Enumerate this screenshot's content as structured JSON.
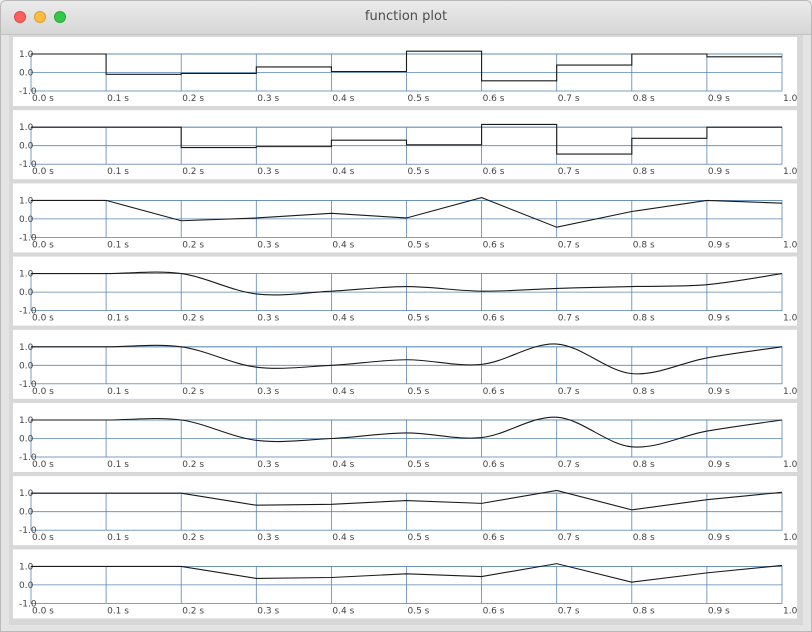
{
  "window": {
    "title": "function plot"
  },
  "colors": {
    "grid": "#5a86b3",
    "curve": "#1a1a1a",
    "panel": "#ffffff",
    "separator": "#d8d8d8"
  },
  "chart_data": [
    {
      "type": "line",
      "interpolation": "step",
      "x": [
        0.0,
        0.1,
        0.2,
        0.3,
        0.4,
        0.5,
        0.6,
        0.7,
        0.8,
        0.9,
        1.0
      ],
      "values": [
        1.0,
        -0.1,
        -0.05,
        0.3,
        0.05,
        1.15,
        -0.45,
        0.4,
        1.0,
        0.85
      ],
      "x_ticks": [
        "0.0 s",
        "0.1 s",
        "0.2 s",
        "0.3 s",
        "0.4 s",
        "0.5 s",
        "0.6 s",
        "0.7 s",
        "0.8 s",
        "0.9 s",
        "1.0"
      ],
      "y_ticks": [
        "1.0",
        "0.0",
        "-1.0"
      ],
      "ylim": [
        -1.0,
        1.0
      ]
    },
    {
      "type": "line",
      "interpolation": "step",
      "x": [
        0.0,
        0.1,
        0.2,
        0.3,
        0.4,
        0.5,
        0.6,
        0.7,
        0.8,
        0.9,
        1.0
      ],
      "values": [
        1.0,
        1.0,
        -0.1,
        -0.05,
        0.3,
        0.05,
        1.15,
        -0.45,
        0.4,
        1.0
      ],
      "x_ticks": [
        "0.0 s",
        "0.1 s",
        "0.2 s",
        "0.3 s",
        "0.4 s",
        "0.5 s",
        "0.6 s",
        "0.7 s",
        "0.8 s",
        "0.9 s",
        "1.0"
      ],
      "y_ticks": [
        "1.0",
        "0.0",
        "-1.0"
      ],
      "ylim": [
        -1.0,
        1.0
      ]
    },
    {
      "type": "line",
      "interpolation": "linear",
      "x": [
        0.0,
        0.1,
        0.2,
        0.3,
        0.4,
        0.5,
        0.6,
        0.7,
        0.8,
        0.9,
        1.0
      ],
      "values": [
        1.0,
        1.0,
        -0.1,
        0.05,
        0.3,
        0.05,
        1.15,
        -0.45,
        0.4,
        1.0,
        0.85
      ],
      "x_ticks": [
        "0.0 s",
        "0.1 s",
        "0.2 s",
        "0.3 s",
        "0.4 s",
        "0.5 s",
        "0.6 s",
        "0.7 s",
        "0.8 s",
        "0.9 s",
        "1.0"
      ],
      "y_ticks": [
        "1.0",
        "0.0",
        "-1.0"
      ],
      "ylim": [
        -1.0,
        1.0
      ]
    },
    {
      "type": "line",
      "interpolation": "smooth",
      "x": [
        0.0,
        0.1,
        0.2,
        0.3,
        0.4,
        0.5,
        0.6,
        0.7,
        0.8,
        0.9,
        1.0
      ],
      "values": [
        1.0,
        1.0,
        1.0,
        -0.1,
        0.05,
        0.3,
        0.05,
        0.2,
        0.3,
        0.4,
        1.0
      ],
      "x_ticks": [
        "0.0 s",
        "0.1 s",
        "0.2 s",
        "0.3 s",
        "0.4 s",
        "0.5 s",
        "0.6 s",
        "0.7 s",
        "0.8 s",
        "0.9 s",
        "1.0"
      ],
      "y_ticks": [
        "1.0",
        "0.0",
        "-1.0"
      ],
      "ylim": [
        -1.0,
        1.0
      ]
    },
    {
      "type": "line",
      "interpolation": "smooth",
      "x": [
        0.0,
        0.1,
        0.2,
        0.3,
        0.4,
        0.5,
        0.6,
        0.7,
        0.8,
        0.9,
        1.0
      ],
      "values": [
        1.0,
        1.0,
        1.0,
        -0.1,
        0.0,
        0.3,
        0.05,
        1.15,
        -0.45,
        0.4,
        1.0
      ],
      "x_ticks": [
        "0.0 s",
        "0.1 s",
        "0.2 s",
        "0.3 s",
        "0.4 s",
        "0.5 s",
        "0.6 s",
        "0.7 s",
        "0.8 s",
        "0.9 s",
        "1.0"
      ],
      "y_ticks": [
        "1.0",
        "0.0",
        "-1.0"
      ],
      "ylim": [
        -1.0,
        1.0
      ]
    },
    {
      "type": "line",
      "interpolation": "smooth",
      "x": [
        0.0,
        0.1,
        0.2,
        0.3,
        0.4,
        0.5,
        0.6,
        0.7,
        0.8,
        0.9,
        1.0
      ],
      "values": [
        1.0,
        1.0,
        1.0,
        -0.1,
        0.0,
        0.3,
        0.05,
        1.15,
        -0.45,
        0.4,
        1.0
      ],
      "x_ticks": [
        "0.0 s",
        "0.1 s",
        "0.2 s",
        "0.3 s",
        "0.4 s",
        "0.5 s",
        "0.6 s",
        "0.7 s",
        "0.8 s",
        "0.9 s",
        "1.0"
      ],
      "y_ticks": [
        "1.0",
        "0.0",
        "-1.0"
      ],
      "ylim": [
        -1.0,
        1.0
      ]
    },
    {
      "type": "line",
      "interpolation": "linear",
      "x": [
        0.0,
        0.1,
        0.2,
        0.3,
        0.4,
        0.5,
        0.6,
        0.7,
        0.8,
        0.9,
        1.0
      ],
      "values": [
        1.0,
        1.0,
        1.0,
        0.35,
        0.4,
        0.6,
        0.45,
        1.15,
        0.1,
        0.65,
        1.05
      ],
      "x_ticks": [
        "0.0 s",
        "0.1 s",
        "0.2 s",
        "0.3 s",
        "0.4 s",
        "0.5 s",
        "0.6 s",
        "0.7 s",
        "0.8 s",
        "0.9 s",
        "1.0"
      ],
      "y_ticks": [
        "1.0",
        "0.0",
        "-1.0"
      ],
      "ylim": [
        -1.0,
        1.0
      ]
    },
    {
      "type": "line",
      "interpolation": "linear",
      "x": [
        0.0,
        0.1,
        0.2,
        0.3,
        0.4,
        0.5,
        0.6,
        0.7,
        0.8,
        0.9,
        1.0
      ],
      "values": [
        1.0,
        1.0,
        1.0,
        0.35,
        0.4,
        0.6,
        0.45,
        1.15,
        0.15,
        0.65,
        1.05
      ],
      "x_ticks": [
        "0.0 s",
        "0.1 s",
        "0.2 s",
        "0.3 s",
        "0.4 s",
        "0.5 s",
        "0.6 s",
        "0.7 s",
        "0.8 s",
        "0.9 s",
        "1.0"
      ],
      "y_ticks": [
        "1.0",
        "0.0",
        "-1.0"
      ],
      "ylim": [
        -1.0,
        1.0
      ]
    }
  ]
}
